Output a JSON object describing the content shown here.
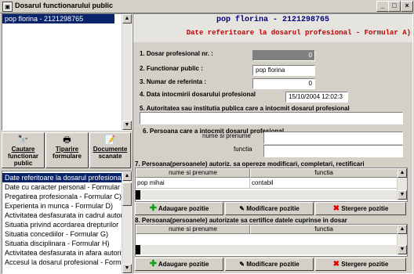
{
  "window": {
    "title": "Dosarul functionarului public",
    "min": "_",
    "max": "□",
    "close": "×"
  },
  "employees": [
    {
      "label": "pop florina - 2121298765",
      "selected": true
    }
  ],
  "tools": [
    {
      "label1": "Cautare",
      "label2": "functionar",
      "label3": "public",
      "icon": "binoculars-icon",
      "glyph": "🔭"
    },
    {
      "label1": "Tiparire",
      "label2": "formulare",
      "label3": "",
      "icon": "printer-icon",
      "glyph": "🖶"
    },
    {
      "label1": "Documente",
      "label2": "scanate",
      "label3": "",
      "icon": "scanned-documents-icon",
      "glyph": "📝"
    }
  ],
  "nav": [
    {
      "label": "Date referitoare la dosarul profesional",
      "selected": true
    },
    {
      "label": "Date cu caracter personal - Formular B)"
    },
    {
      "label": "Pregatirea profesionala - Formular C)"
    },
    {
      "label": "Experienta in munca - Formular D)"
    },
    {
      "label": "Activitatea desfasurata in cadrul autoritatii"
    },
    {
      "label": "Situatia privind acordarea drepturilor"
    },
    {
      "label": "Situatia concediilor - Formular G)"
    },
    {
      "label": "Situatia disciplinara - Formular H)"
    },
    {
      "label": "Activitatea desfasurata in afara autoritatii"
    },
    {
      "label": "Accesul la dosarul profesional - Formular"
    }
  ],
  "header": {
    "employee": "pop florina - 2121298765",
    "form_title": "Date referitoare la dosarul profesional - Formular A)"
  },
  "form": {
    "f1_label": "1. Dosar profesional nr. :",
    "f1_value": "0",
    "f2_label": "2. Functionar public :",
    "f2_value": "pop florina",
    "f3_label": "3. Numar de referinta :",
    "f3_value": "0",
    "f4_label": "4. Data intocmirii dosarului profesional",
    "f4_value": "15/10/2004 12:02:3",
    "f5_label": "5. Autoritatea sau institutia publica care a intocmit dosarul profesional",
    "f5_value": "",
    "f6_label": "6. Persoana care a intocmit dosarul profesional",
    "f6_name_label": "nume si prenume",
    "f6_name_value": "",
    "f6_func_label": "functia",
    "f6_func_value": ""
  },
  "section7": {
    "title": "7. Persoana(persoanele) autoriz. sa opereze modificari, completari, rectificari",
    "col1": "nume si prenume",
    "col2": "functia",
    "rows": [
      {
        "name": "pop mihai",
        "function": "contabil"
      }
    ]
  },
  "section8": {
    "title": "8. Persoana(persoanele) autorizate sa certifice datele cuprinse in dosar",
    "col1": "nume si prenume",
    "col2": "functia"
  },
  "actions": {
    "add": "Adaugare pozitie",
    "modify": "Modificare pozitie",
    "delete": "Stergere pozitie"
  },
  "colors": {
    "title_blue": "#000080",
    "title_red": "#c00000",
    "selection": "#0a246a"
  }
}
